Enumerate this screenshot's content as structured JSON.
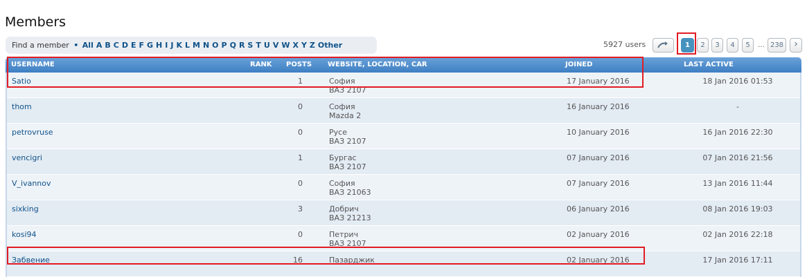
{
  "page": {
    "title": "Members"
  },
  "filter": {
    "lead": "Find a member",
    "bullet": "•",
    "letters": [
      "All",
      "A",
      "B",
      "C",
      "D",
      "E",
      "F",
      "G",
      "H",
      "I",
      "J",
      "K",
      "L",
      "M",
      "N",
      "O",
      "P",
      "Q",
      "R",
      "S",
      "T",
      "U",
      "V",
      "W",
      "X",
      "Y",
      "Z",
      "Other"
    ]
  },
  "pagination": {
    "count_text": "5927 users",
    "jump_icon": "jump-to-page-icon",
    "pages": [
      "1",
      "2",
      "3",
      "4",
      "5"
    ],
    "ellipsis": "…",
    "last_page": "238",
    "next_icon": "chevron-right-icon",
    "next_glyph": "›",
    "active_page": "1"
  },
  "table": {
    "headers": {
      "username": "USERNAME",
      "rank": "RANK",
      "posts": "POSTS",
      "location": "WEBSITE, LOCATION, CAR",
      "joined": "JOINED",
      "last_active": "LAST ACTIVE"
    },
    "rows": [
      {
        "username": "Satio",
        "posts": "1",
        "location": "София",
        "car": "ВАЗ 2107",
        "joined": "17 January 2016",
        "last_active": "18 Jan 2016 01:53"
      },
      {
        "username": "thom",
        "posts": "0",
        "location": "София",
        "car": "Mazda 2",
        "joined": "16 January 2016",
        "last_active": "-"
      },
      {
        "username": "petrovruse",
        "posts": "0",
        "location": "Русе",
        "car": "ВАЗ 2107",
        "joined": "10 January 2016",
        "last_active": "16 Jan 2016 22:30"
      },
      {
        "username": "vencigri",
        "posts": "1",
        "location": "Бургас",
        "car": "ВАЗ 2107",
        "joined": "07 January 2016",
        "last_active": "07 Jan 2016 21:56"
      },
      {
        "username": "V_ivannov",
        "posts": "0",
        "location": "София",
        "car": "ВАЗ 21063",
        "joined": "07 January 2016",
        "last_active": "13 Jan 2016 11:44"
      },
      {
        "username": "sixking",
        "posts": "3",
        "location": "Добрич",
        "car": "ВАЗ 21213",
        "joined": "06 January 2016",
        "last_active": "08 Jan 2016 19:03"
      },
      {
        "username": "kosi94",
        "posts": "0",
        "location": "Петрич",
        "car": "ВАЗ 2107",
        "joined": "02 January 2016",
        "last_active": "02 Jan 2016 22:18"
      },
      {
        "username": "Забвение",
        "posts": "16",
        "location": "Пазарджик",
        "car": "",
        "joined": "02 January 2016",
        "last_active": "17 Jan 2016 17:11"
      }
    ]
  },
  "colors": {
    "accent": "#3e7fc3",
    "link": "#105289",
    "highlight": "#e21b23"
  }
}
